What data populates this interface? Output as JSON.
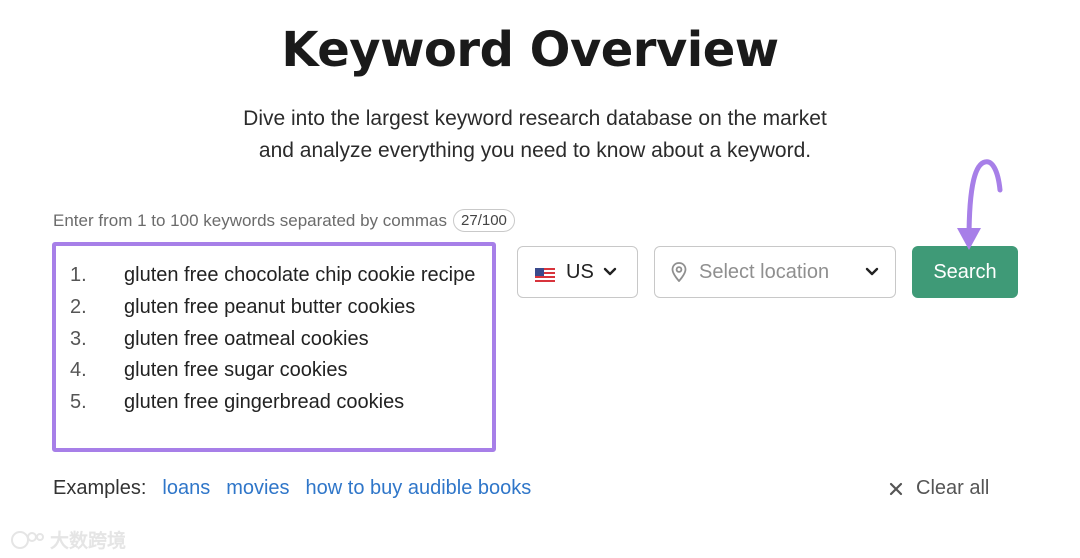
{
  "title": "Keyword Overview",
  "subtitle": {
    "line1": "Dive into the largest keyword research database on the market",
    "line2": "and analyze everything you need to know about a keyword."
  },
  "keywords_input": {
    "hint": "Enter from 1 to 100 keywords separated by commas",
    "counter": "27/100",
    "items": [
      {
        "num": "1.",
        "text": "gluten free chocolate chip cookie recipe"
      },
      {
        "num": "2.",
        "text": "gluten free peanut butter cookies"
      },
      {
        "num": "3.",
        "text": "gluten free oatmeal cookies"
      },
      {
        "num": "4.",
        "text": "gluten free sugar cookies"
      },
      {
        "num": "5.",
        "text": "gluten free gingerbread cookies"
      }
    ]
  },
  "country_select": {
    "value": "US",
    "flag_icon": "us-flag-icon"
  },
  "location_select": {
    "placeholder": "Select location",
    "icon": "map-pin-icon"
  },
  "search_button": {
    "label": "Search",
    "color": "#3f9a77"
  },
  "examples": {
    "label": "Examples:",
    "links": [
      "loans",
      "movies",
      "how to buy audible books"
    ]
  },
  "clear_all": {
    "label": "Clear all"
  },
  "watermark": {
    "text": "大数跨境"
  },
  "colors": {
    "highlight": "#a77fe8",
    "link": "#2f76c9"
  }
}
